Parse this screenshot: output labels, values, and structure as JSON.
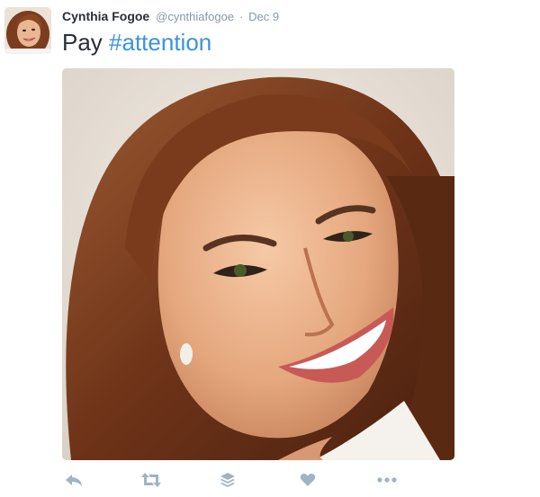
{
  "tweet": {
    "author_name": "Cynthia Fogoe",
    "author_handle": "@cynthiafogoe",
    "separator": "·",
    "date": "Dec 9",
    "text_plain": "Pay ",
    "hashtag": "#attention"
  },
  "media": {
    "alt_description": ""
  },
  "actions": [
    {
      "icon": "reply-icon"
    },
    {
      "icon": "retweet-icon"
    },
    {
      "icon": "buffer-icon"
    },
    {
      "icon": "like-icon"
    },
    {
      "icon": "more-icon"
    }
  ],
  "colors": {
    "name": "#292f33",
    "meta": "#8899a6",
    "hashtag": "#3b94d9",
    "action_icons": "#a0b4c2"
  }
}
